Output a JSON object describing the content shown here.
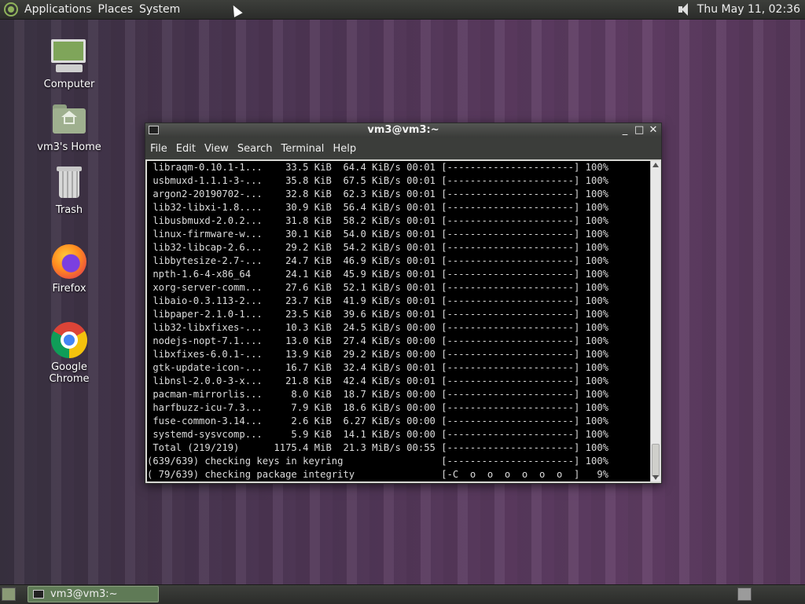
{
  "top_panel": {
    "menus": [
      "Applications",
      "Places",
      "System"
    ],
    "clock": "Thu May 11, 02:36",
    "volume_icon": "speaker-icon"
  },
  "desktop_icons": [
    {
      "label": "Computer",
      "icon": "computer-icon"
    },
    {
      "label": "vm3's Home",
      "icon": "home-folder-icon"
    },
    {
      "label": "Trash",
      "icon": "trash-icon"
    },
    {
      "label": "Firefox",
      "icon": "firefox-icon"
    },
    {
      "label": "Google Chrome",
      "icon": "chrome-icon"
    }
  ],
  "terminal": {
    "title": "vm3@vm3:~",
    "controls": [
      "_",
      "□",
      "✕"
    ],
    "menu": [
      "File",
      "Edit",
      "View",
      "Search",
      "Terminal",
      "Help"
    ],
    "lines": [
      " libraqm-0.10.1-1...    33.5 KiB  64.4 KiB/s 00:01 [----------------------] 100%",
      " usbmuxd-1.1.1-3-...    35.8 KiB  67.5 KiB/s 00:01 [----------------------] 100%",
      " argon2-20190702-...    32.8 KiB  62.3 KiB/s 00:01 [----------------------] 100%",
      " lib32-libxi-1.8....    30.9 KiB  56.4 KiB/s 00:01 [----------------------] 100%",
      " libusbmuxd-2.0.2...    31.8 KiB  58.2 KiB/s 00:01 [----------------------] 100%",
      " linux-firmware-w...    30.1 KiB  54.0 KiB/s 00:01 [----------------------] 100%",
      " lib32-libcap-2.6...    29.2 KiB  54.2 KiB/s 00:01 [----------------------] 100%",
      " libbytesize-2.7-...    24.7 KiB  46.9 KiB/s 00:01 [----------------------] 100%",
      " npth-1.6-4-x86_64      24.1 KiB  45.9 KiB/s 00:01 [----------------------] 100%",
      " xorg-server-comm...    27.6 KiB  52.1 KiB/s 00:01 [----------------------] 100%",
      " libaio-0.3.113-2...    23.7 KiB  41.9 KiB/s 00:01 [----------------------] 100%",
      " libpaper-2.1.0-1...    23.5 KiB  39.6 KiB/s 00:01 [----------------------] 100%",
      " lib32-libxfixes-...    10.3 KiB  24.5 KiB/s 00:00 [----------------------] 100%",
      " nodejs-nopt-7.1....    13.0 KiB  27.4 KiB/s 00:00 [----------------------] 100%",
      " libxfixes-6.0.1-...    13.9 KiB  29.2 KiB/s 00:00 [----------------------] 100%",
      " gtk-update-icon-...    16.7 KiB  32.4 KiB/s 00:01 [----------------------] 100%",
      " libnsl-2.0.0-3-x...    21.8 KiB  42.4 KiB/s 00:01 [----------------------] 100%",
      " pacman-mirrorlis...     8.0 KiB  18.7 KiB/s 00:00 [----------------------] 100%",
      " harfbuzz-icu-7.3...     7.9 KiB  18.6 KiB/s 00:00 [----------------------] 100%",
      " fuse-common-3.14...     2.6 KiB  6.27 KiB/s 00:00 [----------------------] 100%",
      " systemd-sysvcomp...     5.9 KiB  14.1 KiB/s 00:00 [----------------------] 100%",
      " Total (219/219)      1175.4 MiB  21.3 MiB/s 00:55 [----------------------] 100%",
      "(639/639) checking keys in keyring                 [----------------------] 100%",
      "( 79/639) checking package integrity               [-C  o  o  o  o  o  o  ]   9%"
    ]
  },
  "taskbar": {
    "window_label": "vm3@vm3:~"
  }
}
